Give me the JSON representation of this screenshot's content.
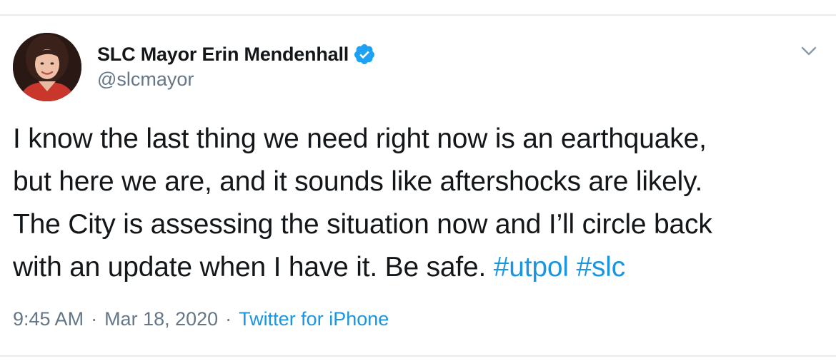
{
  "tweet": {
    "author": {
      "display_name": "SLC Mayor Erin Mendenhall",
      "handle": "@slcmayor",
      "verified": true,
      "avatar_icon": "avatar-photo"
    },
    "text_lines": [
      "I know the last thing we need right now is an earthquake,",
      "but here we are, and it sounds like aftershocks are likely.",
      "The City is assessing the situation now and I’ll circle back",
      "with an update when I have it. Be safe. "
    ],
    "hashtags": [
      "#utpol",
      "#slc"
    ],
    "time": "9:45 AM",
    "date": "Mar 18, 2020",
    "separator": "·",
    "source": "Twitter for iPhone"
  },
  "icons": {
    "verified": "verified-badge-icon",
    "caret": "chevron-down-icon"
  },
  "colors": {
    "link": "#1b95e0",
    "text": "#14171a",
    "secondary": "#657786",
    "divider": "#e6ecf0",
    "verified_badge": "#1da1f2"
  }
}
